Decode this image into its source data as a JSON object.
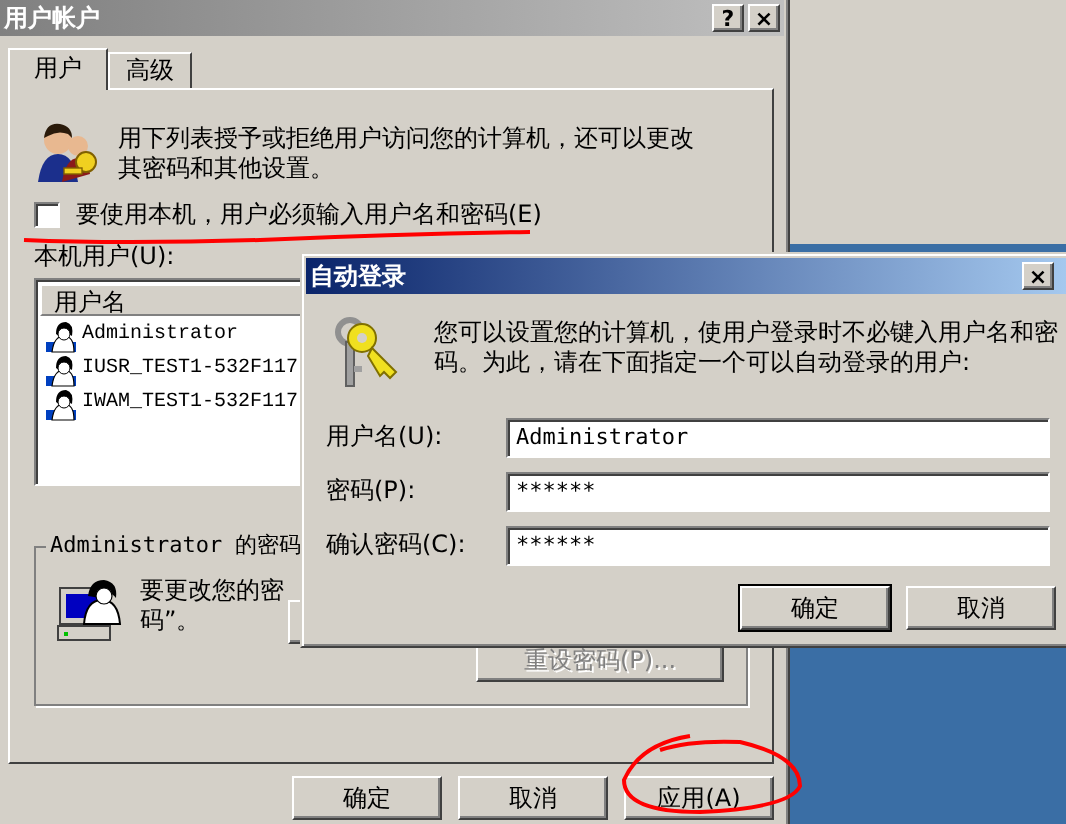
{
  "main_window": {
    "title": "用户帐户",
    "title_buttons": [
      "?",
      "×"
    ],
    "tabs": [
      {
        "label": "用户",
        "selected": true
      },
      {
        "label": "高级",
        "selected": false
      }
    ],
    "intro_text": "用下列表授予或拒绝用户访问您的计算机，还可以更改其密码和其他设置。",
    "require_login": {
      "label": "要使用本机，用户必须输入用户名和密码(E)",
      "checked": false
    },
    "users_label": "本机用户(U):",
    "users_list": {
      "columns": [
        "用户名"
      ],
      "rows": [
        "Administrator",
        "IUSR_TEST1-532F117",
        "IWAM_TEST1-532F117"
      ]
    },
    "password_group": {
      "title": "Administrator 的密码",
      "text_lines": [
        "要更改您的密",
        "码”。"
      ],
      "reset_button": {
        "label": "重设密码(P)...",
        "disabled": true
      }
    },
    "buttons": [
      "确定",
      "取消",
      "应用(A)"
    ]
  },
  "autologin_dialog": {
    "title": "自动登录",
    "close": "×",
    "intro": "您可以设置您的计算机，使用户登录时不必键入用户名和密码。为此，请在下面指定一个可以自动登录的用户:",
    "fields": [
      {
        "label": "用户名(U):",
        "value": "Administrator"
      },
      {
        "label": "密码(P):",
        "value": "******"
      },
      {
        "label": "确认密码(C):",
        "value": "******"
      }
    ],
    "buttons": [
      "确定",
      "取消"
    ]
  },
  "annotations": {
    "underline_under_option": true,
    "circle_around_apply": true
  }
}
